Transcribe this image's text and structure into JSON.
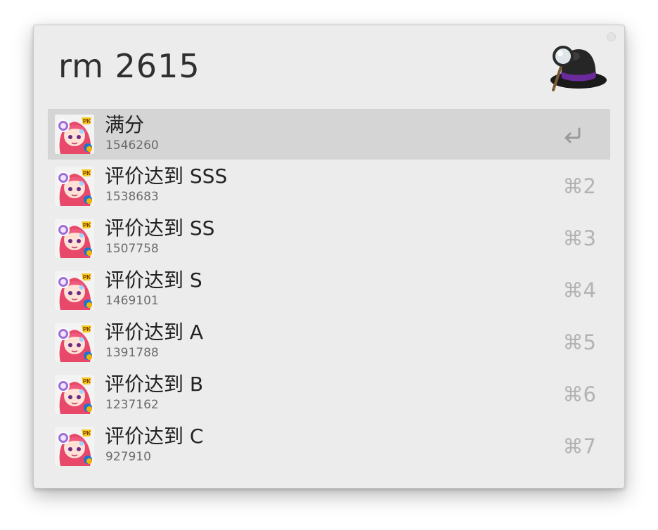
{
  "search": {
    "query": "rm 2615",
    "logo_icon": "alfred-hat-logo-icon"
  },
  "results": [
    {
      "title": "满分",
      "subtitle": "1546260",
      "shortcut": "",
      "shortcut_icon": "return-key-icon",
      "selected": true,
      "icon": "app-icon-anime-girl"
    },
    {
      "title": "评价达到 SSS",
      "subtitle": "1538683",
      "shortcut": "⌘2",
      "selected": false,
      "icon": "app-icon-anime-girl"
    },
    {
      "title": "评价达到 SS",
      "subtitle": "1507758",
      "shortcut": "⌘3",
      "selected": false,
      "icon": "app-icon-anime-girl"
    },
    {
      "title": "评价达到 S",
      "subtitle": "1469101",
      "shortcut": "⌘4",
      "selected": false,
      "icon": "app-icon-anime-girl"
    },
    {
      "title": "评价达到 A",
      "subtitle": "1391788",
      "shortcut": "⌘5",
      "selected": false,
      "icon": "app-icon-anime-girl"
    },
    {
      "title": "评价达到 B",
      "subtitle": "1237162",
      "shortcut": "⌘6",
      "selected": false,
      "icon": "app-icon-anime-girl"
    },
    {
      "title": "评价达到 C",
      "subtitle": "927910",
      "shortcut": "⌘7",
      "selected": false,
      "icon": "app-icon-anime-girl"
    }
  ],
  "colors": {
    "window_bg": "#ececec",
    "selected_row_bg": "#d5d5d5",
    "title_text": "#222222",
    "subtitle_text": "#6c6c6c",
    "shortcut_text": "#b3b3b3"
  }
}
